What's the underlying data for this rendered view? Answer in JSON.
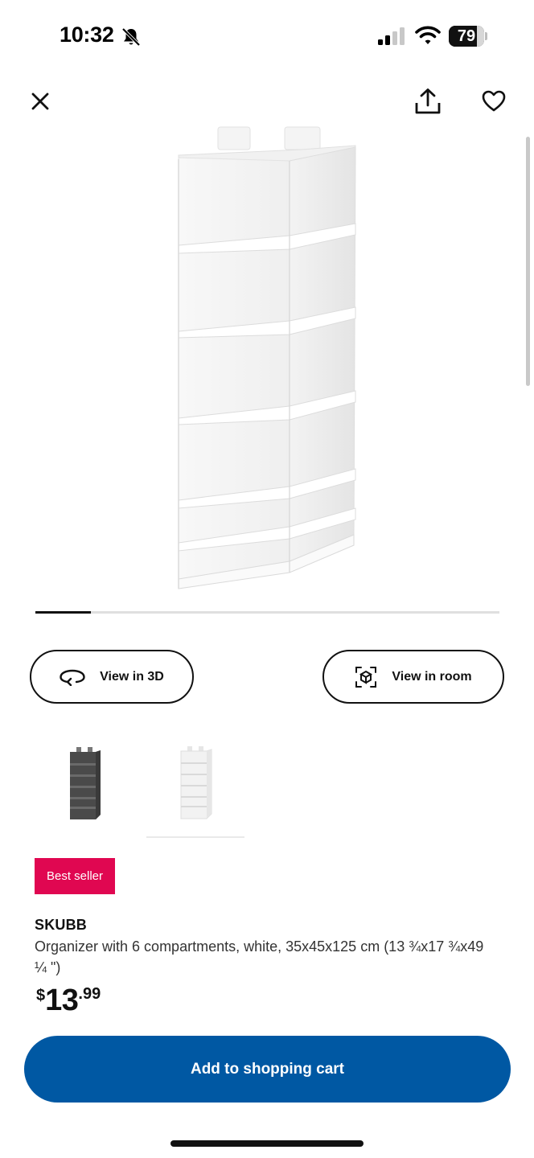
{
  "status_bar": {
    "time": "10:32",
    "battery_level": "79",
    "battery_fraction": 0.79,
    "icons": [
      "bell-slash-icon",
      "cellular-signal-icon",
      "wifi-icon",
      "battery-icon"
    ]
  },
  "nav": {
    "icons": [
      "close-icon",
      "share-icon",
      "heart-icon"
    ]
  },
  "gallery": {
    "progress_fraction": 0.12,
    "image_subject": "white six-compartment hanging organizer"
  },
  "actions": {
    "view_3d_label": "View in 3D",
    "view_room_label": "View in room",
    "icons": [
      "rotate-3d-icon",
      "ar-cube-icon"
    ]
  },
  "variants": [
    {
      "name": "dark grey",
      "color": "#4a4a4a"
    },
    {
      "name": "white",
      "color": "#f2f2f2",
      "selected": true
    }
  ],
  "product": {
    "badge": "Best seller",
    "badge_color": "#e00751",
    "name": "SKUBB",
    "description": "Organizer with 6 compartments, white, 35x45x125 cm (13 ¾x17 ¾x49 ¼ \")",
    "price": {
      "currency": "$",
      "integer": "13",
      "decimal": ".99"
    }
  },
  "cta": {
    "label": "Add to shopping cart",
    "color": "#0058a3"
  }
}
